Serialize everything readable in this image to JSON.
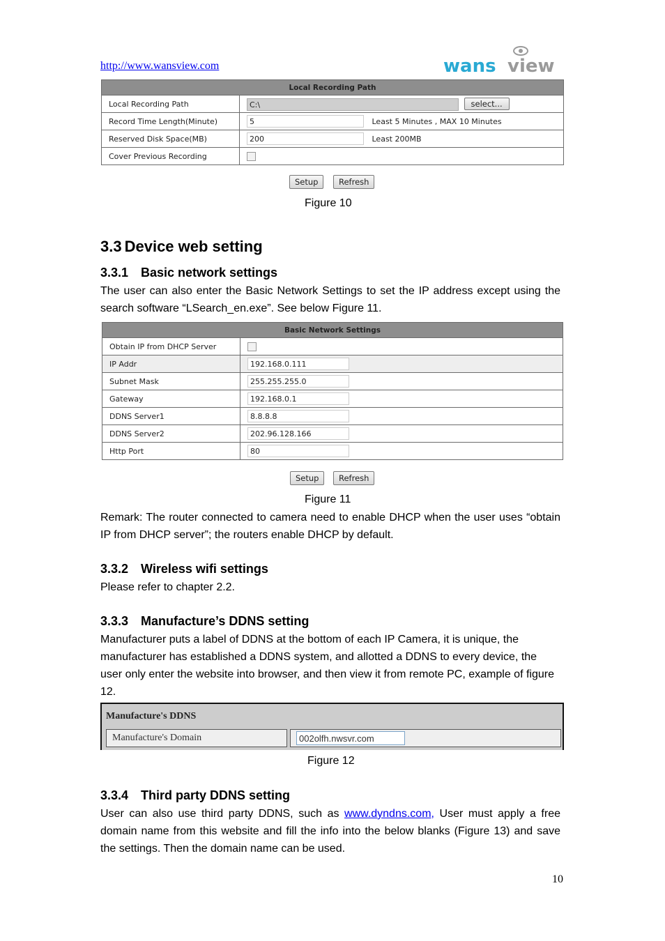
{
  "header": {
    "link": "http://www.wansview.com",
    "logo": {
      "part1": "wans",
      "part2": "view",
      "colors": {
        "part1": "#29a9d3",
        "part2": "#9a9a9a"
      }
    }
  },
  "figure10": {
    "title": "Local Recording Path",
    "rows": [
      {
        "label": "Local Recording Path",
        "value": "C:\\",
        "button": "select..."
      },
      {
        "label": "Record Time Length(Minute)",
        "value": "5",
        "hint": "Least 5 Minutes , MAX 10 Minutes"
      },
      {
        "label": "Reserved Disk Space(MB)",
        "value": "200",
        "hint": "Least 200MB"
      },
      {
        "label": "Cover Previous Recording",
        "checked": false
      }
    ],
    "buttons": {
      "setup": "Setup",
      "refresh": "Refresh"
    },
    "caption": "Figure 10"
  },
  "section33": {
    "title": "3.3 Device web setting",
    "num": "3.3",
    "text": "Device web setting"
  },
  "s331": {
    "num": "3.3.1",
    "title": "Basic network settings",
    "body": "The user can also enter the Basic Network Settings to set the IP address except using the search software “LSearch_en.exe”. See below Figure 11."
  },
  "figure11": {
    "title": "Basic Network Settings",
    "dhcp_label": "Obtain IP from DHCP Server",
    "dhcp_checked": false,
    "rows": [
      {
        "label": "IP Addr",
        "value": "192.168.0.111"
      },
      {
        "label": "Subnet Mask",
        "value": "255.255.255.0"
      },
      {
        "label": "Gateway",
        "value": "192.168.0.1"
      },
      {
        "label": "DDNS Server1",
        "value": "8.8.8.8"
      },
      {
        "label": "DDNS Server2",
        "value": "202.96.128.166"
      },
      {
        "label": "Http Port",
        "value": "80"
      }
    ],
    "buttons": {
      "setup": "Setup",
      "refresh": "Refresh"
    },
    "caption": "Figure 11"
  },
  "remark": "Remark: The router connected to camera need to enable DHCP when the user uses “obtain IP from DHCP server”; the routers enable DHCP by default.",
  "s332": {
    "num": "3.3.2",
    "title": "Wireless wifi settings",
    "body": "Please refer to chapter 2.2."
  },
  "s333": {
    "num": "3.3.3",
    "title": "Manufacture’s DDNS setting",
    "body": "Manufacturer puts a label of DDNS at the bottom of each IP Camera, it is unique, the manufacturer has established a DDNS system, and allotted a DDNS to every device, the user only enter the website into browser, and then view it from remote PC, example of figure 12."
  },
  "figure12": {
    "title": "Manufacture's DDNS",
    "label": "Manufacture's Domain",
    "value": "002olfh.nwsvr.com",
    "caption": "Figure 12"
  },
  "s334": {
    "num": "3.3.4",
    "title": "Third party DDNS setting",
    "body_before": "User can also use third party DDNS, such as ",
    "link": "www.dyndns.com,",
    "body_after": " User must apply a free domain name from this website and fill the info into the below blanks (Figure 13) and save the settings. Then the domain name can be used."
  },
  "page_number": "10"
}
